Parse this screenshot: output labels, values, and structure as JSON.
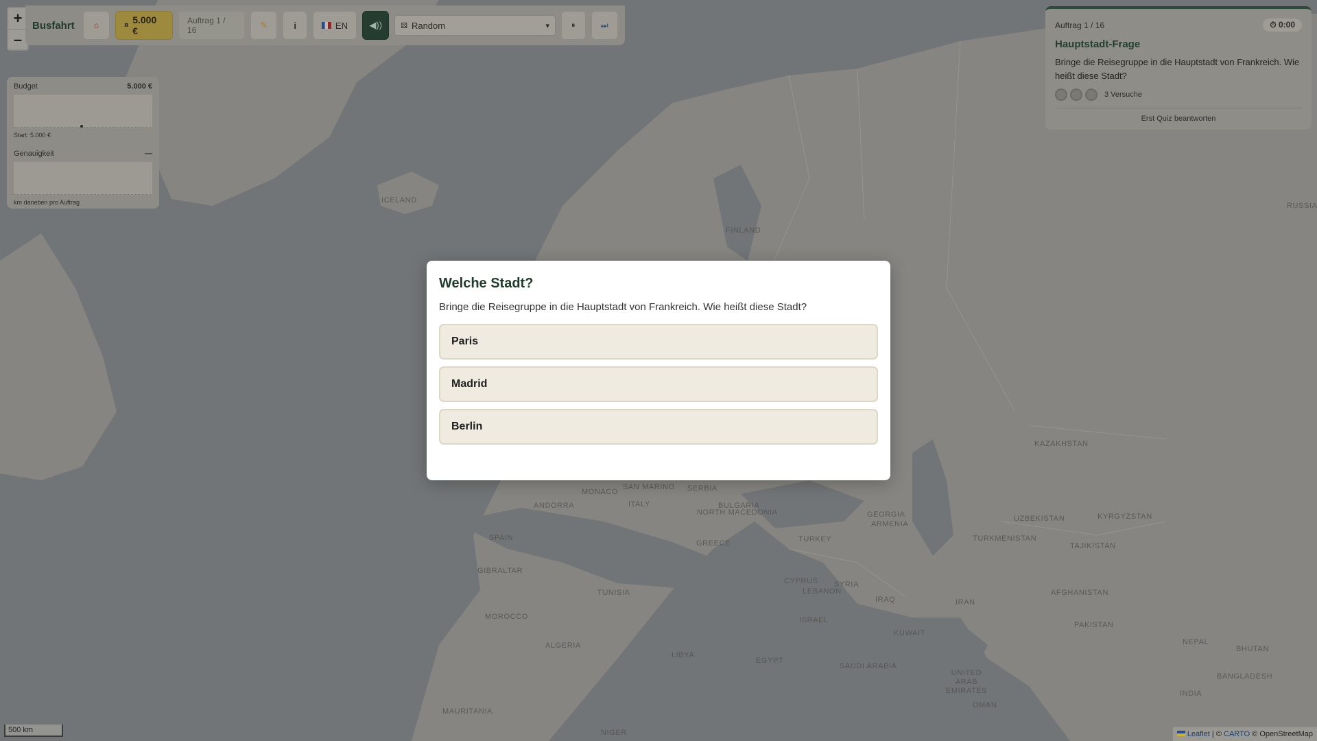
{
  "app": {
    "title": "Busfahrt"
  },
  "zoom": {
    "in": "+",
    "out": "–"
  },
  "toolbar": {
    "home_icon": "home-icon",
    "money": "5.000 €",
    "mission": "Auftrag 1 / 16",
    "ticket_icon": "ticket-icon",
    "info": "i",
    "lang": "EN",
    "sound_icon": "speaker-icon",
    "mode_select": "Random",
    "pause": "⏸",
    "skip": "⏭"
  },
  "stats": {
    "budget_label": "Budget",
    "budget_value": "5.000 €",
    "budget_start": "Start: 5.000 €",
    "accuracy_label": "Genauigkeit",
    "accuracy_value": "—",
    "accuracy_sub": "km daneben pro Auftrag"
  },
  "mission_card": {
    "counter": "Auftrag 1 / 16",
    "timer": "⏱ 0:00",
    "title": "Hauptstadt-Frage",
    "text": "Bringe die Reisegruppe in die Hauptstadt von Frankreich. Wie heißt diese Stadt?",
    "tries": "3 Versuche",
    "footer": "Erst Quiz beantworten"
  },
  "modal": {
    "title": "Welche Stadt?",
    "question": "Bringe die Reisegruppe in die Hauptstadt von Frankreich. Wie heißt diese Stadt?",
    "answers": [
      "Paris",
      "Madrid",
      "Berlin"
    ]
  },
  "map_labels": [
    {
      "text": "Iceland"
    },
    {
      "text": "Finland"
    },
    {
      "text": "Russia"
    },
    {
      "text": "Kazakhstan"
    },
    {
      "text": "Uzbekistan"
    },
    {
      "text": "Kyrgyzstan"
    },
    {
      "text": "Turkmenistan"
    },
    {
      "text": "Tajikistan"
    },
    {
      "text": "Georgia"
    },
    {
      "text": "Armenia"
    },
    {
      "text": "Turkey"
    },
    {
      "text": "Greece"
    },
    {
      "text": "Bulgaria"
    },
    {
      "text": "Serbia"
    },
    {
      "text": "North Macedonia"
    },
    {
      "text": "Italy"
    },
    {
      "text": "San Marino"
    },
    {
      "text": "Monaco"
    },
    {
      "text": "Andorra"
    },
    {
      "text": "Spain"
    },
    {
      "text": "Gibraltar"
    },
    {
      "text": "Morocco"
    },
    {
      "text": "Algeria"
    },
    {
      "text": "Tunisia"
    },
    {
      "text": "Libya"
    },
    {
      "text": "Egypt"
    },
    {
      "text": "Cyprus"
    },
    {
      "text": "Lebanon"
    },
    {
      "text": "Syria"
    },
    {
      "text": "Israel"
    },
    {
      "text": "Iraq"
    },
    {
      "text": "Kuwait"
    },
    {
      "text": "Iran"
    },
    {
      "text": "Saudi Arabia"
    },
    {
      "text": "United Arab Emirates"
    },
    {
      "text": "Oman"
    },
    {
      "text": "Afghanistan"
    },
    {
      "text": "Pakistan"
    },
    {
      "text": "Nepal"
    },
    {
      "text": "Bhutan"
    },
    {
      "text": "Bangladesh"
    },
    {
      "text": "India"
    },
    {
      "text": "Mauritania"
    },
    {
      "text": "Niger"
    }
  ],
  "scale": "500 km",
  "attribution": {
    "leaflet": "Leaflet",
    "carto": "CARTO",
    "osm": "© OpenStreetMap"
  }
}
